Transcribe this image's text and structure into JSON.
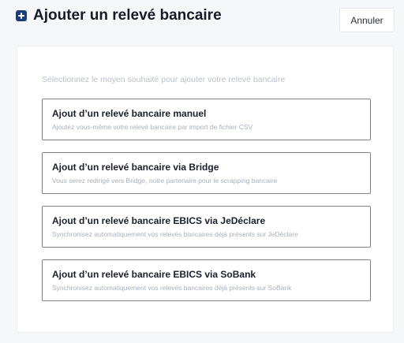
{
  "header": {
    "title": "Ajouter un relevé bancaire",
    "cancel_label": "Annuler",
    "icon": "plus-square-icon",
    "accent_color": "#1b3d7a"
  },
  "panel": {
    "instruction": "Sélectionnez le moyen souhaité pour ajouter votre relevé bancaire",
    "options": [
      {
        "title": "Ajout d’un relevé bancaire manuel",
        "description": "Ajoutez vous-même votre relevé bancaire par import de fichier CSV"
      },
      {
        "title": "Ajout d’un relevé bancaire via Bridge",
        "description": "Vous serez redirigé vers Bridge, notre partenaire pour le scrapping bancaire"
      },
      {
        "title": "Ajout d’un relevé bancaire EBICS via JeDéclare",
        "description": "Synchronisez automatiquement vos relevés bancaires déjà présents sur JeDéclare"
      },
      {
        "title": "Ajout d’un relevé bancaire EBICS via SoBank",
        "description": "Synchronisez automatiquement vos relevés bancaires déjà présents sur SoBank"
      }
    ]
  }
}
